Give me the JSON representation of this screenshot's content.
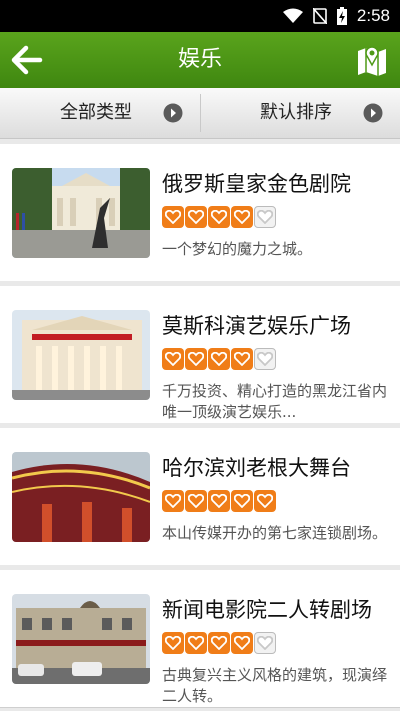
{
  "status_bar": {
    "time": "2:58"
  },
  "header": {
    "title": "娱乐"
  },
  "filters": {
    "category": "全部类型",
    "sort": "默认排序"
  },
  "colors": {
    "header_green": "#4e9a17",
    "rating_orange": "#f07d18"
  },
  "venues": [
    {
      "name": "俄罗斯皇家金色剧院",
      "rating": 4,
      "max_rating": 5,
      "description": "一个梦幻的魔力之城。"
    },
    {
      "name": "莫斯科演艺娱乐广场",
      "rating": 4,
      "max_rating": 5,
      "description": "千万投资、精心打造的黑龙江省内唯一顶级演艺娱乐..."
    },
    {
      "name": "哈尔滨刘老根大舞台",
      "rating": 5,
      "max_rating": 5,
      "description": "本山传媒开办的第七家连锁剧场。"
    },
    {
      "name": "新闻电影院二人转剧场",
      "rating": 4,
      "max_rating": 5,
      "description": "古典复兴主义风格的建筑，现演绎二人转。"
    }
  ]
}
